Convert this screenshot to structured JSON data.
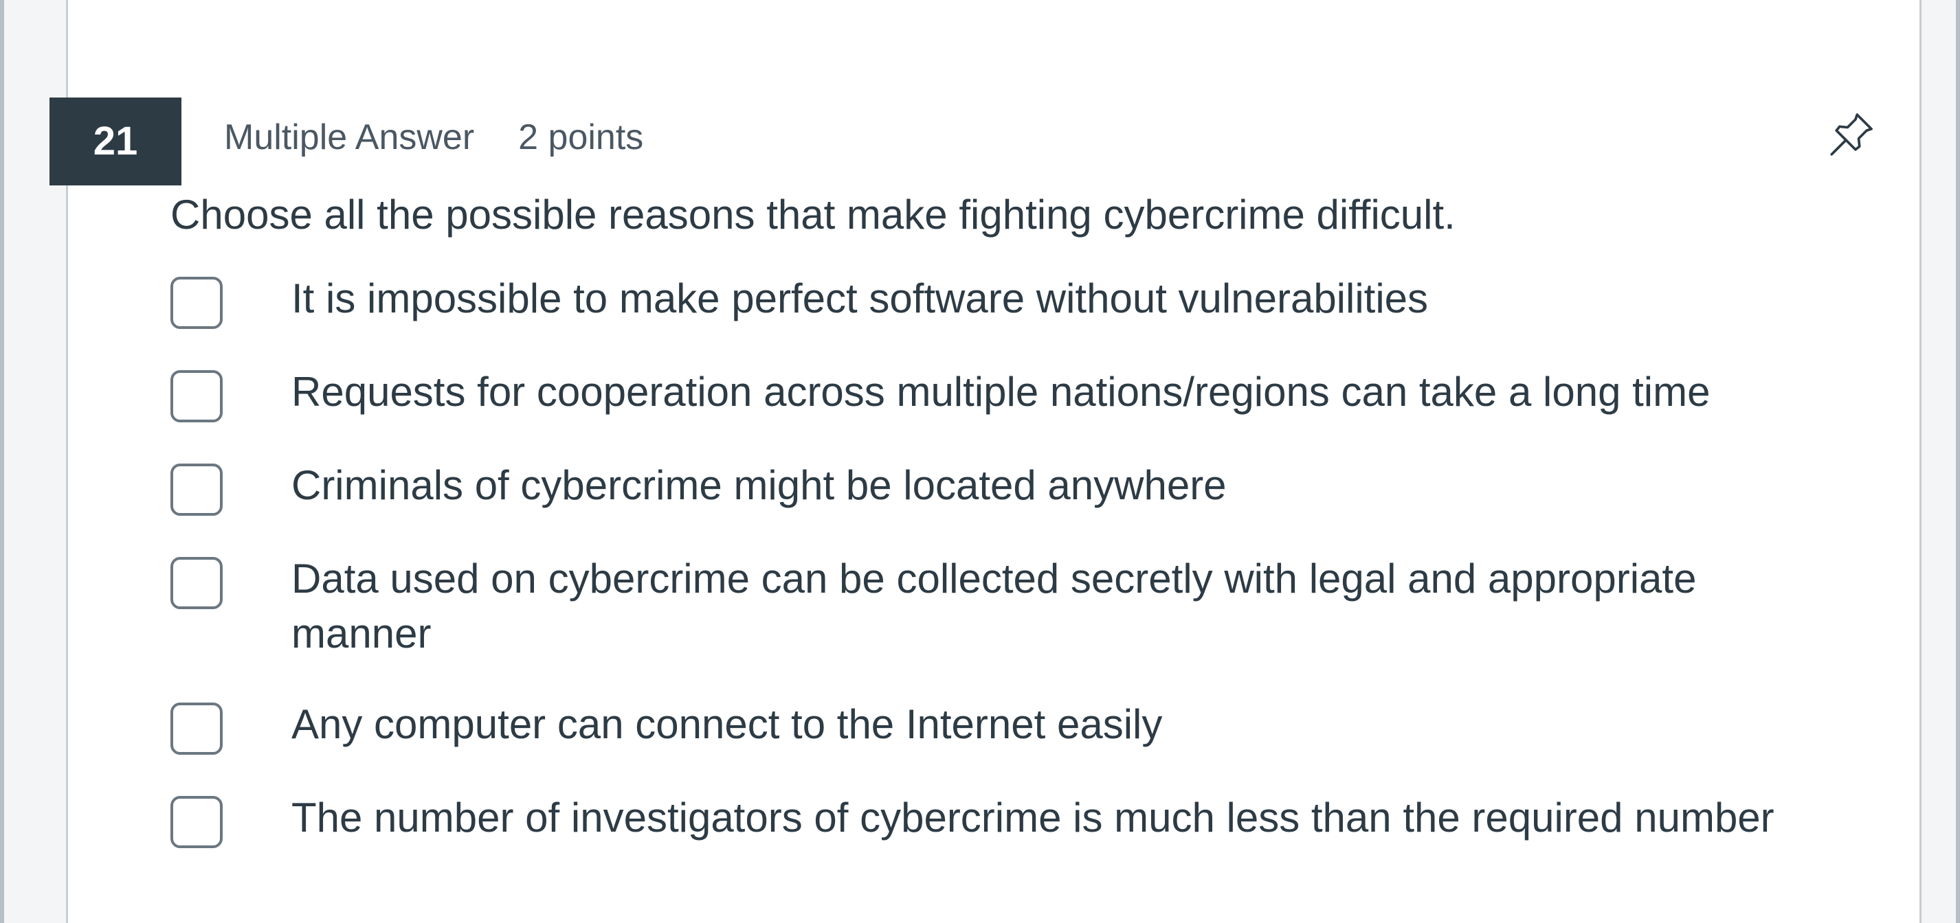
{
  "question": {
    "number": "21",
    "type": "Multiple Answer",
    "points": "2 points",
    "prompt": "Choose all the possible reasons that make fighting cybercrime difficult.",
    "pin_icon": "pushpin-icon",
    "answers": [
      {
        "label": "It is impossible to make perfect software without vulnerabilities",
        "checked": false
      },
      {
        "label": "Requests for cooperation across multiple nations/regions can take a long time",
        "checked": false
      },
      {
        "label": "Criminals of cybercrime might be located anywhere",
        "checked": false
      },
      {
        "label": "Data used on cybercrime can be collected secretly with legal and appropriate manner",
        "checked": false
      },
      {
        "label": "Any computer can connect to the Internet easily",
        "checked": false
      },
      {
        "label": "The number of investigators of cybercrime is much less than the required number",
        "checked": false
      }
    ]
  },
  "colors": {
    "header_badge": "#2d3b45",
    "text": "#2d3b45",
    "meta_text": "#4b5863",
    "border": "#c7cdd1"
  }
}
